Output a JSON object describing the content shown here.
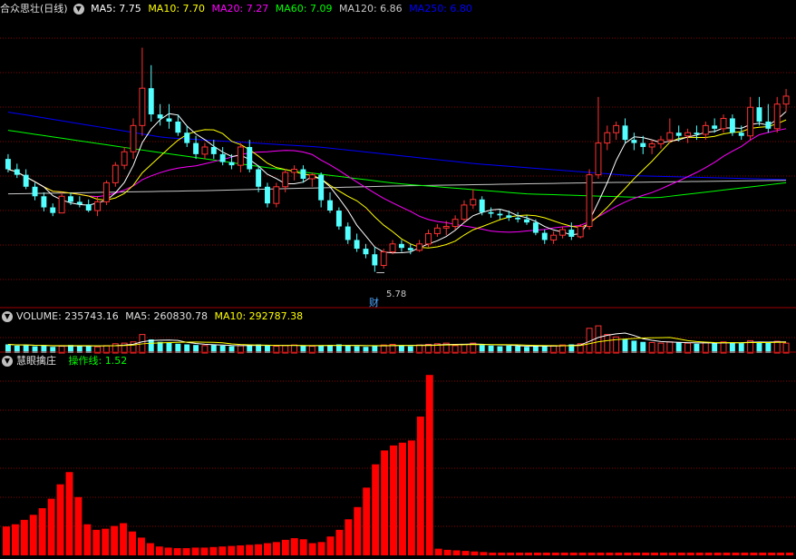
{
  "main": {
    "title": "合众思壮(日线)",
    "ma": [
      {
        "label": "MA5: 7.75",
        "color": "#ffffff"
      },
      {
        "label": "MA10: 7.70",
        "color": "#ffff00"
      },
      {
        "label": "MA20: 7.27",
        "color": "#ff00ff"
      },
      {
        "label": "MA60: 7.09",
        "color": "#00ff00"
      },
      {
        "label": "MA120: 6.86",
        "color": "#c8c8c8"
      },
      {
        "label": "MA250: 6.80",
        "color": "#0000ff"
      }
    ],
    "low_marker": "5.78",
    "event_label": "财"
  },
  "volume": {
    "title": "VOLUME: 235743.16",
    "ma5": "MA5: 260830.78",
    "ma10": "MA10: 292787.38"
  },
  "indicator": {
    "title": "慧眼擒庄",
    "line": "操作线: 1.52",
    "line_color": "#00ff00"
  },
  "colors": {
    "up": "#ff3232",
    "down": "#54ffff",
    "grid": "#8b0000",
    "divider": "#a00000",
    "ind_bar": "#ff0000"
  },
  "chart_data": {
    "type": "candlestick",
    "note": "estimated daily OHLC prices read from the screenshot",
    "ohlc": [
      [
        7.16,
        7.22,
        6.99,
        7.03
      ],
      [
        7.03,
        7.1,
        6.92,
        6.96
      ],
      [
        6.96,
        7.03,
        6.78,
        6.81
      ],
      [
        6.81,
        6.86,
        6.64,
        6.69
      ],
      [
        6.69,
        6.74,
        6.5,
        6.55
      ],
      [
        6.55,
        6.6,
        6.44,
        6.48
      ],
      [
        6.48,
        6.74,
        6.48,
        6.69
      ],
      [
        6.69,
        6.74,
        6.58,
        6.62
      ],
      [
        6.62,
        6.69,
        6.55,
        6.59
      ],
      [
        6.59,
        6.65,
        6.49,
        6.51
      ],
      [
        6.51,
        6.69,
        6.44,
        6.62
      ],
      [
        6.62,
        6.89,
        6.58,
        6.86
      ],
      [
        6.86,
        7.12,
        6.81,
        7.08
      ],
      [
        7.08,
        7.31,
        7.03,
        7.25
      ],
      [
        7.25,
        7.67,
        7.16,
        7.58
      ],
      [
        7.58,
        8.56,
        7.45,
        8.05
      ],
      [
        8.05,
        8.34,
        7.63,
        7.72
      ],
      [
        7.72,
        7.85,
        7.58,
        7.67
      ],
      [
        7.67,
        7.85,
        7.54,
        7.63
      ],
      [
        7.63,
        7.72,
        7.45,
        7.49
      ],
      [
        7.49,
        7.58,
        7.31,
        7.36
      ],
      [
        7.36,
        7.45,
        7.16,
        7.22
      ],
      [
        7.22,
        7.36,
        7.16,
        7.31
      ],
      [
        7.31,
        7.4,
        7.16,
        7.22
      ],
      [
        7.22,
        7.31,
        7.08,
        7.12
      ],
      [
        7.12,
        7.22,
        7.03,
        7.08
      ],
      [
        7.08,
        7.36,
        6.99,
        7.31
      ],
      [
        7.31,
        7.4,
        6.99,
        7.03
      ],
      [
        7.03,
        7.08,
        6.74,
        6.81
      ],
      [
        6.81,
        6.86,
        6.55,
        6.6
      ],
      [
        6.6,
        6.86,
        6.55,
        6.81
      ],
      [
        6.81,
        7.03,
        6.74,
        6.99
      ],
      [
        6.99,
        7.08,
        6.89,
        7.03
      ],
      [
        7.03,
        7.08,
        6.86,
        6.91
      ],
      [
        6.91,
        6.99,
        6.81,
        6.96
      ],
      [
        6.96,
        6.99,
        6.55,
        6.64
      ],
      [
        6.64,
        6.74,
        6.48,
        6.51
      ],
      [
        6.51,
        6.55,
        6.27,
        6.31
      ],
      [
        6.31,
        6.36,
        6.09,
        6.14
      ],
      [
        6.14,
        6.22,
        5.99,
        6.03
      ],
      [
        6.03,
        6.09,
        5.91,
        5.96
      ],
      [
        5.96,
        6.05,
        5.74,
        5.82
      ],
      [
        5.82,
        6.03,
        5.78,
        5.99
      ],
      [
        5.99,
        6.14,
        5.96,
        6.09
      ],
      [
        6.09,
        6.14,
        5.99,
        6.04
      ],
      [
        6.04,
        6.09,
        5.96,
        6.01
      ],
      [
        6.01,
        6.14,
        5.99,
        6.09
      ],
      [
        6.09,
        6.27,
        6.05,
        6.22
      ],
      [
        6.22,
        6.34,
        6.18,
        6.29
      ],
      [
        6.29,
        6.38,
        6.2,
        6.31
      ],
      [
        6.31,
        6.45,
        6.27,
        6.4
      ],
      [
        6.4,
        6.64,
        6.36,
        6.58
      ],
      [
        6.58,
        6.78,
        6.53,
        6.65
      ],
      [
        6.65,
        6.69,
        6.45,
        6.49
      ],
      [
        6.49,
        6.55,
        6.42,
        6.47
      ],
      [
        6.47,
        6.53,
        6.4,
        6.45
      ],
      [
        6.45,
        6.51,
        6.38,
        6.42
      ],
      [
        6.42,
        6.49,
        6.36,
        6.4
      ],
      [
        6.4,
        6.45,
        6.33,
        6.36
      ],
      [
        6.36,
        6.4,
        6.2,
        6.23
      ],
      [
        6.23,
        6.27,
        6.09,
        6.14
      ],
      [
        6.14,
        6.25,
        6.09,
        6.2
      ],
      [
        6.2,
        6.31,
        6.16,
        6.27
      ],
      [
        6.27,
        6.36,
        6.14,
        6.18
      ],
      [
        6.18,
        6.34,
        6.16,
        6.31
      ],
      [
        6.31,
        7.03,
        6.27,
        6.96
      ],
      [
        6.96,
        7.94,
        6.91,
        7.36
      ],
      [
        7.36,
        7.58,
        7.27,
        7.49
      ],
      [
        7.49,
        7.63,
        7.4,
        7.58
      ],
      [
        7.58,
        7.67,
        7.36,
        7.4
      ],
      [
        7.4,
        7.49,
        7.27,
        7.36
      ],
      [
        7.36,
        7.45,
        7.22,
        7.31
      ],
      [
        7.31,
        7.4,
        7.22,
        7.35
      ],
      [
        7.35,
        7.45,
        7.29,
        7.4
      ],
      [
        7.4,
        7.67,
        7.36,
        7.49
      ],
      [
        7.49,
        7.58,
        7.38,
        7.45
      ],
      [
        7.45,
        7.54,
        7.36,
        7.49
      ],
      [
        7.49,
        7.58,
        7.4,
        7.47
      ],
      [
        7.47,
        7.63,
        7.4,
        7.58
      ],
      [
        7.58,
        7.67,
        7.49,
        7.54
      ],
      [
        7.54,
        7.72,
        7.49,
        7.67
      ],
      [
        7.67,
        7.72,
        7.45,
        7.49
      ],
      [
        7.49,
        7.58,
        7.4,
        7.45
      ],
      [
        7.45,
        7.94,
        7.4,
        7.81
      ],
      [
        7.81,
        7.94,
        7.58,
        7.63
      ],
      [
        7.63,
        7.85,
        7.49,
        7.54
      ],
      [
        7.54,
        7.94,
        7.49,
        7.85
      ],
      [
        7.85,
        8.04,
        7.75,
        7.95
      ]
    ],
    "ma250": [
      7.75,
      7.43,
      7.31,
      7.1,
      6.95,
      6.9
    ],
    "ma120": [
      6.72,
      6.76,
      6.82,
      6.86,
      6.89
    ],
    "ma60": [
      7.52,
      7.28,
      7.05,
      6.85,
      6.72,
      6.67,
      6.86
    ],
    "ylim": [
      5.3,
      9.0
    ],
    "volume": [
      14,
      12,
      13,
      11,
      12,
      10,
      11,
      13,
      12,
      11,
      10,
      12,
      15,
      16,
      18,
      30,
      22,
      18,
      17,
      15,
      14,
      13,
      12,
      13,
      12,
      11,
      12,
      13,
      14,
      12,
      11,
      12,
      13,
      12,
      11,
      12,
      13,
      14,
      12,
      11,
      10,
      12,
      13,
      14,
      12,
      11,
      13,
      14,
      15,
      16,
      12,
      14,
      16,
      13,
      12,
      11,
      12,
      11,
      10,
      12,
      11,
      12,
      13,
      14,
      15,
      40,
      44,
      30,
      26,
      22,
      20,
      18,
      17,
      16,
      18,
      17,
      16,
      15,
      17,
      16,
      18,
      17,
      16,
      20,
      18,
      17,
      19,
      16
    ],
    "volume_ylim": [
      0,
      50
    ],
    "indicator": [
      5.2,
      5.6,
      6.4,
      7.3,
      8.5,
      10.2,
      12.8,
      15.0,
      10.5,
      5.6,
      4.6,
      4.8,
      5.3,
      5.8,
      4.3,
      3.2,
      2.2,
      1.6,
      1.4,
      1.3,
      1.3,
      1.4,
      1.4,
      1.5,
      1.6,
      1.7,
      1.8,
      1.9,
      2.0,
      2.2,
      2.4,
      2.8,
      3.1,
      2.9,
      2.2,
      2.4,
      3.4,
      4.6,
      6.5,
      8.7,
      12.2,
      16.4,
      18.9,
      19.8,
      20.3,
      20.7,
      25.0,
      32.5,
      1.2,
      1.0,
      0.9,
      0.8,
      0.7,
      0.6,
      0.5,
      0.5,
      0.5,
      0.5,
      0.5,
      0.5,
      0.5,
      0.5,
      0.5,
      0.5,
      0.5,
      0.5,
      0.5,
      0.5,
      0.5,
      0.5,
      0.5,
      0.5,
      0.5,
      0.5,
      0.5,
      0.5,
      0.5,
      0.5,
      0.5,
      0.5,
      0.5,
      0.5,
      0.5,
      0.5,
      0.5,
      0.5,
      0.5,
      0.5
    ],
    "indicator_ylim": [
      0,
      34
    ]
  }
}
